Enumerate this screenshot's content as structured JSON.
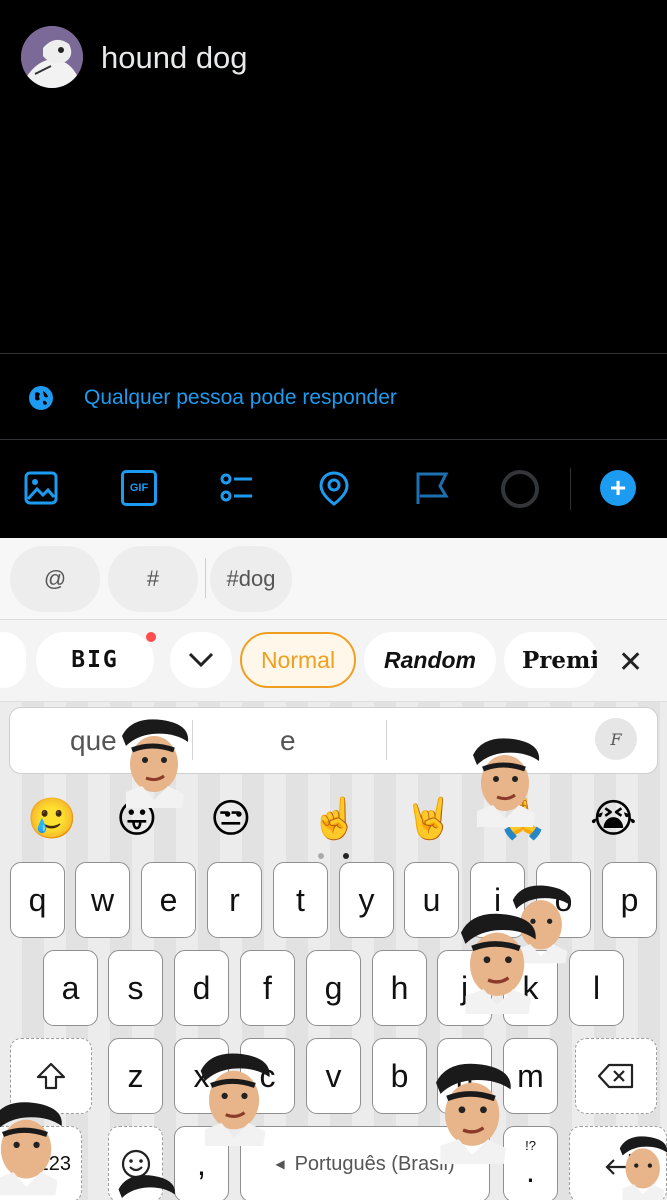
{
  "compose": {
    "text": "hound dog",
    "reply_setting": "Qualquer pessoa pode responder"
  },
  "toolbar": {
    "icons": [
      "image-icon",
      "gif-icon",
      "poll-icon",
      "location-icon",
      "flag-icon"
    ],
    "gif_label": "GIF",
    "add_label": "+"
  },
  "suggestions": {
    "at": "@",
    "hash": "#",
    "tag": "#dog"
  },
  "style_bar": {
    "big": "BIG",
    "normal": "Normal",
    "random": "Random",
    "premium": "Premiu",
    "close": "✕"
  },
  "prediction": {
    "left": "que",
    "middle": "e"
  },
  "emoji_row": [
    "🥲",
    "😛",
    "😒",
    "☝️",
    "🤘",
    "🙏",
    "😭"
  ],
  "keys": {
    "row1": [
      "q",
      "w",
      "e",
      "r",
      "t",
      "y",
      "u",
      "i",
      "o",
      "p"
    ],
    "row2": [
      "a",
      "s",
      "d",
      "f",
      "g",
      "h",
      "j",
      "k",
      "l"
    ],
    "row3": [
      "z",
      "x",
      "c",
      "v",
      "b",
      "n",
      "m"
    ],
    "num": "?123",
    "comma": ",",
    "space": "Português (Brasil)",
    "period": ".",
    "punct_hint": "!?"
  },
  "colors": {
    "accent": "#1d9bf0",
    "normal_pill": "#f0a020"
  }
}
